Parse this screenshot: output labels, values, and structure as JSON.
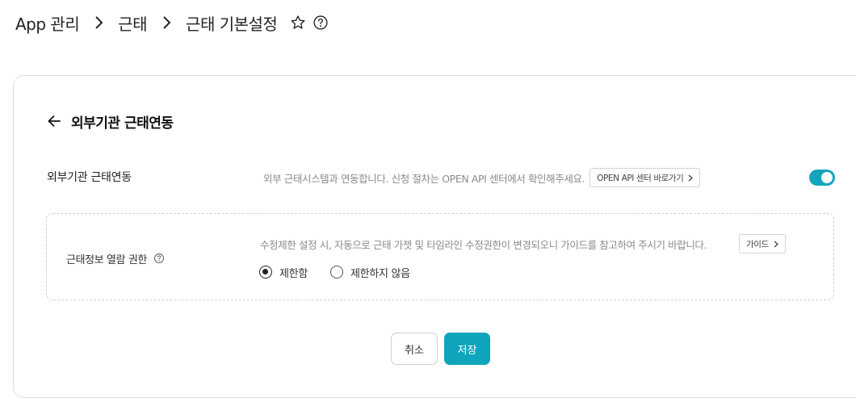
{
  "breadcrumb": {
    "items": [
      "App 관리",
      "근태",
      "근태 기본설정"
    ]
  },
  "section": {
    "title": "외부기관 근태연동"
  },
  "integration": {
    "label": "외부기관 근태연동",
    "description": "외부 근태시스템과 연동합니다. 신청 절차는 OPEN API 센터에서 확인해주세요.",
    "link_button": "OPEN API 센터 바로가기",
    "toggle_on": true,
    "accent_color": "#12a5bd"
  },
  "permission": {
    "label": "근태정보 열람 권한",
    "description": "수정제한 설정 시, 자동으로 근태 가젯 및 타임라인 수정권한이 변경되오니 가이드를 참고하여 주시기 바랍니다.",
    "guide_button": "가이드",
    "options": [
      "제한함",
      "제한하지 않음"
    ],
    "selected": "제한함"
  },
  "actions": {
    "cancel": "취소",
    "save": "저장"
  },
  "icons": {
    "separator": "chevron-right-icon",
    "favorite": "star-outline-icon",
    "help": "question-circle-icon",
    "back": "arrow-left-icon"
  }
}
